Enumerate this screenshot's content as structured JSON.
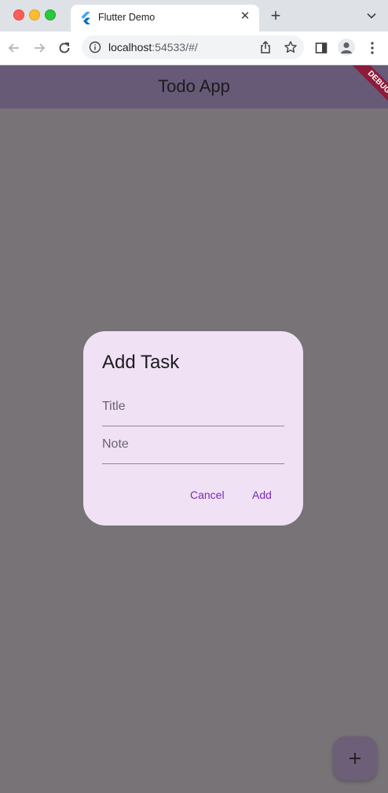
{
  "browser": {
    "tab_title": "Flutter Demo",
    "tab_close": "✕",
    "new_tab": "+",
    "url_host": "localhost",
    "url_rest": ":54533/#/"
  },
  "app": {
    "title": "Todo App",
    "debug_label": "DEBUG",
    "theme": {
      "appbar": "#675a77",
      "dialog_bg": "#f0e1f5",
      "accent": "#7a2ab3",
      "scrim": "#777377"
    }
  },
  "dialog": {
    "title": "Add Task",
    "title_field": {
      "placeholder": "Title",
      "value": ""
    },
    "note_field": {
      "placeholder": "Note",
      "value": ""
    },
    "cancel_label": "Cancel",
    "add_label": "Add"
  },
  "fab": {
    "icon": "plus-icon"
  }
}
